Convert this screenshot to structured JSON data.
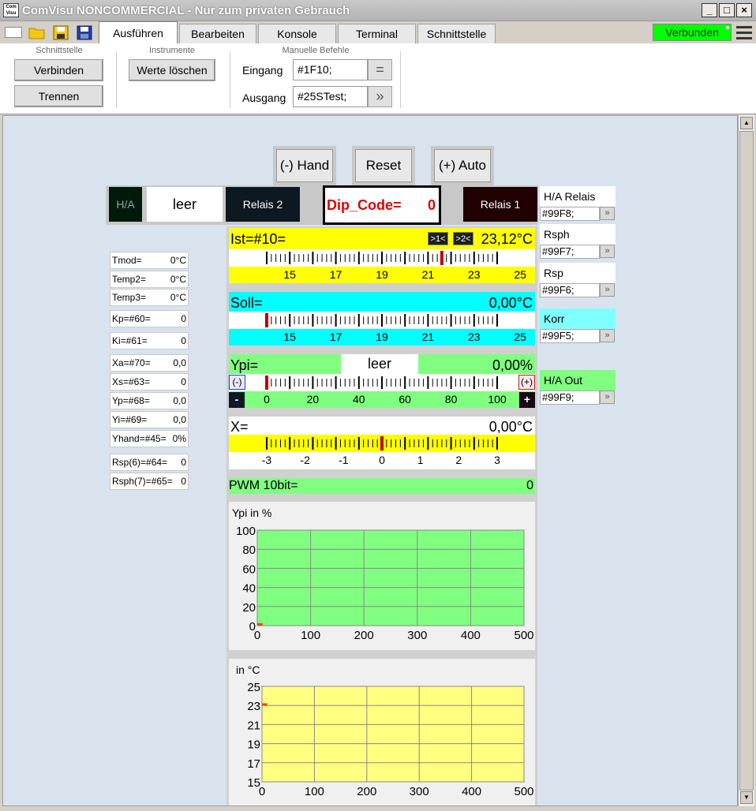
{
  "window": {
    "icon_text": "Com Visu",
    "title": "ComVisu NONCOMMERCIAL - Nur zum privaten Gebrauch",
    "minimize": "_",
    "maximize": "□",
    "close": "×"
  },
  "toolbar": {
    "icons": [
      "new-file-icon",
      "open-folder-icon",
      "save-yellow-icon",
      "save-blue-icon"
    ],
    "tabs": [
      "Ausführen",
      "Bearbeiten",
      "Konsole",
      "Terminal",
      "Schnittstelle"
    ],
    "active_tab": "Ausführen",
    "status": "Verbunden",
    "status_color": "#00ff00"
  },
  "ribbon": {
    "schnittstelle": {
      "title": "Schnittstelle",
      "connect": "Verbinden",
      "disconnect": "Trennen"
    },
    "instrumente": {
      "title": "Instrumente",
      "clear": "Werte löschen"
    },
    "manual": {
      "title": "Manuelle Befehle",
      "input_label": "Eingang",
      "input_value": "#1F10;",
      "input_btn": "=",
      "output_label": "Ausgang",
      "output_value": "#25STest;",
      "output_btn": "»"
    }
  },
  "controls": {
    "hand": "(-) Hand",
    "reset": "Reset",
    "auto": "(+) Auto",
    "ha": "H/A",
    "leer": "leer",
    "relais2": "Relais 2",
    "dip_label": "Dip_Code=",
    "dip_value": "0",
    "relais1": "Relais 1"
  },
  "side_right": [
    {
      "label": "H/A Relais",
      "value": "#99F8;",
      "color": "#ffffff"
    },
    {
      "label": "Rsph",
      "value": "#99F7;",
      "color": "#ffffff"
    },
    {
      "label": "Rsp",
      "value": "#99F6;",
      "color": "#ffffff"
    },
    {
      "label": "Korr",
      "value": "#99F5;",
      "color": "#80ffff"
    },
    {
      "label": "H/A Out",
      "value": "#99F9;",
      "color": "#80ff80"
    }
  ],
  "side_right_btn": "»",
  "side_left": [
    {
      "label": "Tmod=",
      "value": "0°C"
    },
    {
      "label": "Temp2=",
      "value": "0°C"
    },
    {
      "label": "Temp3=",
      "value": "0°C"
    },
    {
      "label": "Kp=#60=",
      "value": "0"
    },
    {
      "label": "Ki=#61=",
      "value": "0"
    },
    {
      "label": "Xa=#70=",
      "value": "0,0"
    },
    {
      "label": "Xs=#63=",
      "value": "0"
    },
    {
      "label": "Yp=#68=",
      "value": "0,0"
    },
    {
      "label": "Yi=#69=",
      "value": "0,0"
    },
    {
      "label": "Yhand=#45=",
      "value": "0%"
    },
    {
      "label": "Rsp(6)=#64=",
      "value": "0"
    },
    {
      "label": "Rsph(7)=#65=",
      "value": "0"
    }
  ],
  "gauges": {
    "ist": {
      "label": "Ist=#10=",
      "btn1": ">1<",
      "btn2": ">2<",
      "value": "23,12°C",
      "ticks": [
        "15",
        "17",
        "19",
        "21",
        "23",
        "25"
      ],
      "min": 14,
      "max": 26,
      "marker": 23.12,
      "bg": "#ffff00"
    },
    "soll": {
      "label": "Soll=",
      "value": "0,00°C",
      "ticks": [
        "15",
        "17",
        "19",
        "21",
        "23",
        "25"
      ],
      "min": 14,
      "max": 26,
      "marker": 14,
      "bg": "#00ffff"
    },
    "ypi": {
      "label": "Ypi=",
      "mid": "leer",
      "value": "0,00%",
      "ticks": [
        "0",
        "20",
        "40",
        "60",
        "80",
        "100"
      ],
      "min": 0,
      "max": 100,
      "marker": 0,
      "bg": "#80ff80",
      "minus_small": "(-)",
      "plus_small": "(+)",
      "minus": "-",
      "plus": "+"
    },
    "x": {
      "label": "X=",
      "value": "0,00°C",
      "ticks": [
        "-3",
        "-2",
        "-1",
        "0",
        "1",
        "2",
        "3"
      ],
      "min": -3,
      "max": 3,
      "marker": 0,
      "bg": "#ffff00"
    },
    "pwm": {
      "label": "PWM 10bit=",
      "value": "0"
    }
  },
  "chart_data": [
    {
      "type": "line",
      "title": "Ypi in %",
      "xlim": [
        0,
        500
      ],
      "ylim": [
        0,
        100
      ],
      "x_ticks": [
        "0",
        "100",
        "200",
        "300",
        "400",
        "500"
      ],
      "y_ticks": [
        "100",
        "80",
        "60",
        "40",
        "20",
        "0"
      ],
      "grid": true,
      "bg": "#80ff80",
      "series": [
        {
          "x": [
            0,
            10
          ],
          "values": [
            0,
            0
          ],
          "color": "#ff4000"
        }
      ]
    },
    {
      "type": "line",
      "title": "in °C",
      "xlim": [
        0,
        500
      ],
      "ylim": [
        15,
        25
      ],
      "x_ticks": [
        "0",
        "100",
        "200",
        "300",
        "400",
        "500"
      ],
      "y_ticks": [
        "25",
        "23",
        "21",
        "19",
        "17",
        "15"
      ],
      "grid": true,
      "bg": "#ffff80",
      "series": [
        {
          "x": [
            0,
            10
          ],
          "values": [
            23.1,
            23.1
          ],
          "color": "#ff4000"
        }
      ]
    }
  ]
}
